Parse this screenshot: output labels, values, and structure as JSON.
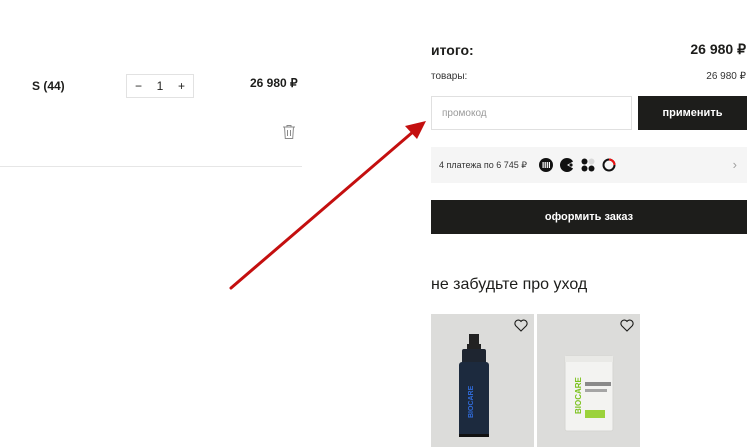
{
  "cart_item": {
    "size": "S (44)",
    "quantity": "1",
    "decrement": "−",
    "increment": "+",
    "price": "26 980 ₽"
  },
  "summary": {
    "total_label": "итого:",
    "total_value": "26 980 ₽",
    "goods_label": "товары:",
    "goods_value": "26 980 ₽"
  },
  "promo": {
    "placeholder": "промокод",
    "apply_label": "применить"
  },
  "split_payment": {
    "text": "4 платежа по 6 745 ₽",
    "chevron": "›"
  },
  "checkout_label": "оформить заказ",
  "care": {
    "title": "не забудьте про уход",
    "products": [
      {
        "brand": "BIOCARE"
      },
      {
        "brand": "BIOCARE"
      }
    ]
  },
  "colors": {
    "dark": "#1d1d1b",
    "arrow": "#c40f0f",
    "card_bg": "#dcdcda"
  }
}
